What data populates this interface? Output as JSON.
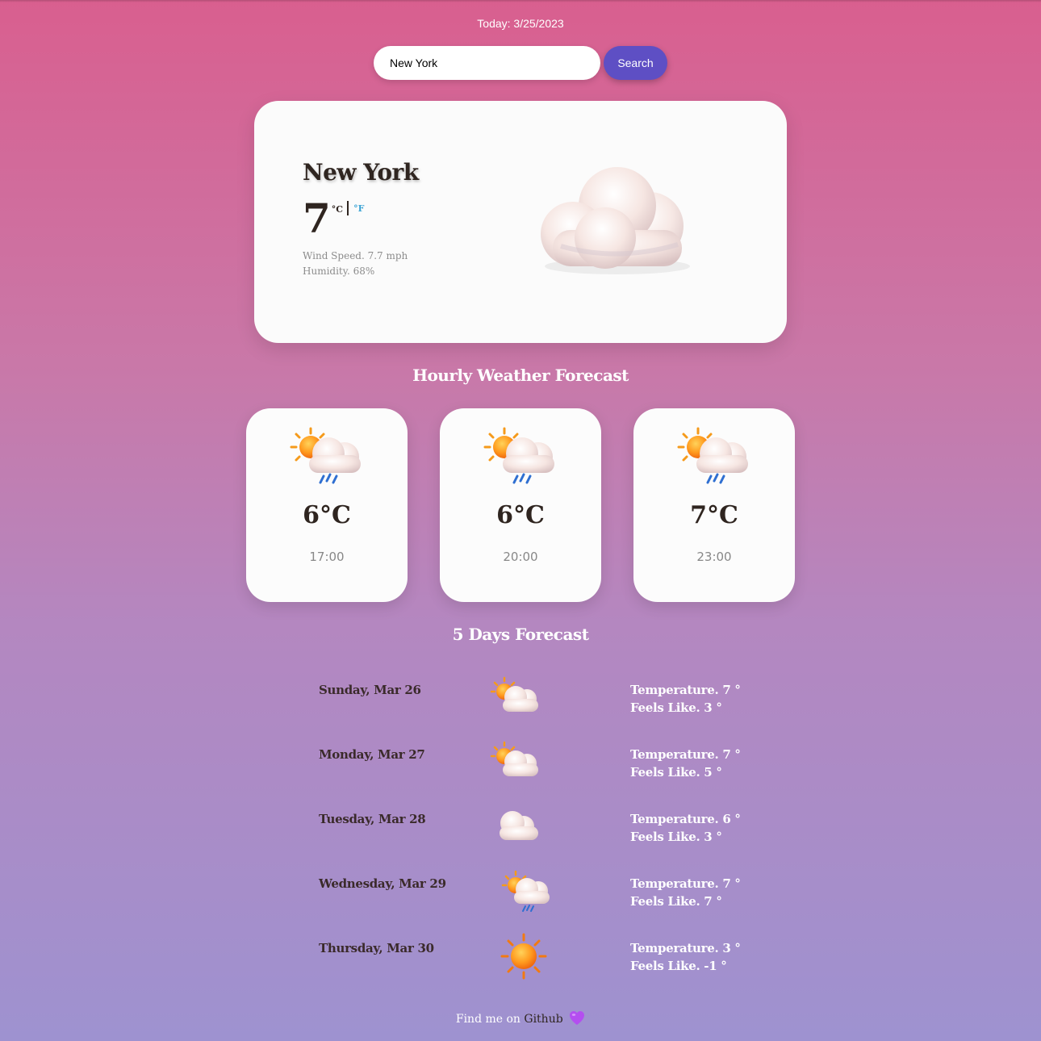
{
  "header": {
    "today": "Today: 3/25/2023"
  },
  "search": {
    "value": "New York",
    "button_label": "Search"
  },
  "current": {
    "city": "New York",
    "temp": "7",
    "unit_c": "°C",
    "unit_f": "°F",
    "wind": "Wind Speed. 7.7 mph",
    "humidity": "Humidity. 68%",
    "icon": "cloud-icon"
  },
  "hourly": {
    "title": "Hourly Weather Forecast",
    "items": [
      {
        "temp": "6°C",
        "time": "17:00",
        "icon": "sun-cloud-rain-icon"
      },
      {
        "temp": "6°C",
        "time": "20:00",
        "icon": "sun-cloud-rain-icon"
      },
      {
        "temp": "7°C",
        "time": "23:00",
        "icon": "sun-cloud-rain-icon"
      }
    ]
  },
  "daily": {
    "title": "5 Days Forecast",
    "items": [
      {
        "day": "Sunday, Mar 26",
        "temp": "Temperature. 7 °",
        "feels": "Feels Like. 3 °",
        "icon": "sun-behind-cloud-icon"
      },
      {
        "day": "Monday, Mar 27",
        "temp": "Temperature. 7 °",
        "feels": "Feels Like. 5 °",
        "icon": "sun-behind-cloud-icon"
      },
      {
        "day": "Tuesday, Mar 28",
        "temp": "Temperature. 6 °",
        "feels": "Feels Like. 3 °",
        "icon": "cloud-icon"
      },
      {
        "day": "Wednesday, Mar 29",
        "temp": "Temperature. 7 °",
        "feels": "Feels Like. 7 °",
        "icon": "sun-cloud-rain-icon"
      },
      {
        "day": "Thursday, Mar 30",
        "temp": "Temperature. 3 °",
        "feels": "Feels Like. -1 °",
        "icon": "sun-icon"
      }
    ]
  },
  "footer": {
    "text": "Find me on ",
    "link": "Github",
    "icon": "purple-heart-icon"
  },
  "colors": {
    "accent": "#5e4fc4",
    "unit_f": "#3aa3d4",
    "heart": "#b44ef0"
  }
}
